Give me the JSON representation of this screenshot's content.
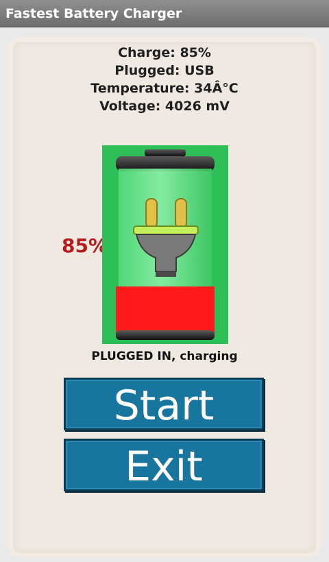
{
  "app": {
    "title": "Fastest Battery Charger"
  },
  "info": {
    "charge": "Charge: 85%",
    "plugged": "Plugged: USB",
    "temperature": "Temperature: 34Â°C",
    "voltage": "Voltage: 4026 mV"
  },
  "battery": {
    "percent_label": "85%",
    "level_fraction": 0.85,
    "status": "PLUGGED IN, charging",
    "icons": [
      "battery-icon",
      "plug-icon"
    ],
    "colors": {
      "background": "#2fbf58",
      "fill": "#ff1a1a"
    }
  },
  "buttons": {
    "start_label": "Start",
    "exit_label": "Exit"
  },
  "colors": {
    "button": "#17759e",
    "percent_text": "#b71c1c"
  }
}
